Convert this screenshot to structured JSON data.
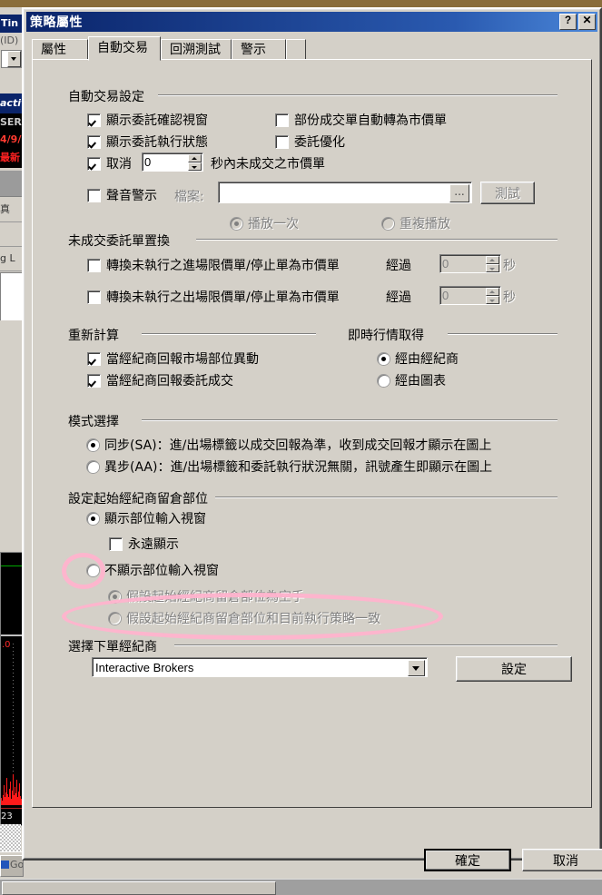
{
  "background": {
    "title_fragment": "Tin",
    "sub_fragment": "(ID)",
    "active_fragment": "activ",
    "ser_fragment": "SER",
    "date_fragment": "4/9/",
    "latest_fragment": "最新",
    "row1_fragment": "真",
    "row3_fragment": "g L",
    "chart_price": ".0",
    "chart_axis": "23",
    "taskbar_item": "Go"
  },
  "dialog": {
    "title": "策略屬性",
    "help_button": "?",
    "close_button": "✕",
    "tabs": [
      {
        "label": "屬性",
        "active": false
      },
      {
        "label": "自動交易",
        "active": true
      },
      {
        "label": "回溯測試",
        "active": false
      },
      {
        "label": "警示",
        "active": false
      }
    ],
    "ok_label": "確定",
    "cancel_label": "取消"
  },
  "auto_trade": {
    "group_label": "自動交易設定",
    "show_order_confirm": {
      "label": "顯示委託確認視窗",
      "checked": true
    },
    "partial_to_market": {
      "label": "部份成交單自動轉為市價單",
      "checked": false
    },
    "show_order_status": {
      "label": "顯示委託執行狀態",
      "checked": true
    },
    "order_optimize": {
      "label": "委託優化",
      "checked": false
    },
    "cancel": {
      "label": "取消",
      "checked": true,
      "value": "0",
      "suffix": "秒內未成交之市價單"
    },
    "sound_alert": {
      "label": "聲音警示",
      "checked": false
    },
    "file_label": "檔案:",
    "file_value": "",
    "browse_label": "...",
    "test_label": "測試",
    "play_once": {
      "label": "播放一次",
      "selected": true
    },
    "play_repeat": {
      "label": "重複播放",
      "selected": false
    }
  },
  "unfilled_replace": {
    "group_label": "未成交委託單置換",
    "entry": {
      "label": "轉換未執行之進場限價單/停止單為市價單",
      "checked": false,
      "after_label": "經過",
      "value": "0",
      "unit": "秒"
    },
    "exit": {
      "label": "轉換未執行之出場限價單/停止單為市價單",
      "checked": false,
      "after_label": "經過",
      "value": "0",
      "unit": "秒"
    }
  },
  "recalc": {
    "group_label": "重新計算",
    "on_position_change": {
      "label": "當經紀商回報市場部位異動",
      "checked": true
    },
    "on_order_fill": {
      "label": "當經紀商回報委託成交",
      "checked": true
    }
  },
  "realtime_quote": {
    "group_label": "即時行情取得",
    "via_broker": {
      "label": "經由經紀商",
      "selected": true
    },
    "via_chart": {
      "label": "經由圖表",
      "selected": false
    }
  },
  "mode_select": {
    "group_label": "模式選擇",
    "sync": {
      "label": "同步(SA)：進/出場標籤以成交回報為準，收到成交回報才顯示在圖上",
      "selected": true
    },
    "async": {
      "label": "異步(AA)：進/出場標籤和委託執行狀況無關，訊號產生即顯示在圖上",
      "selected": false
    }
  },
  "initial_position": {
    "group_label": "設定起始經紀商留倉部位",
    "show_input_window": {
      "label": "顯示部位輸入視窗",
      "selected": true
    },
    "always_show": {
      "label": "永遠顯示",
      "checked": false,
      "disabled": false
    },
    "hide_input_window": {
      "label": "不顯示部位輸入視窗",
      "selected": false
    },
    "assume_flat": {
      "label": "假設起始經紀商留倉部位為空手",
      "selected": true,
      "disabled": true
    },
    "assume_match_strategy": {
      "label": "假設起始經紀商留倉部位和目前執行策略一致",
      "selected": false,
      "disabled": true
    }
  },
  "broker": {
    "group_label": "選擇下單經紀商",
    "selected": "Interactive Brokers",
    "settings_label": "設定"
  },
  "colors": {
    "title_bar_start": "#0a246a",
    "title_bar_end": "#4a86d8",
    "dialog_face": "#d4d0c8",
    "annotation_pink": "#ffb3cd",
    "disabled_text": "#808080"
  }
}
